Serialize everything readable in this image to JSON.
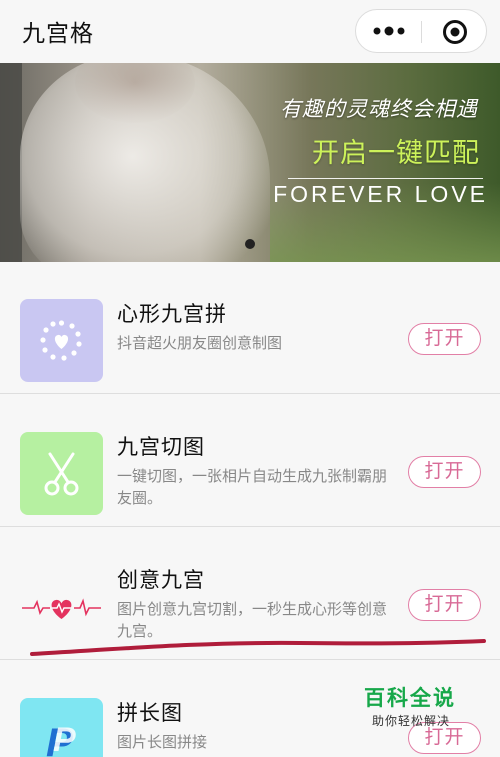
{
  "header": {
    "title": "九宫格",
    "more_icon": "ellipsis-icon",
    "close_icon": "target-circle-icon"
  },
  "banner": {
    "line1": "有趣的灵魂终会相遇",
    "line2": "开启一键匹配",
    "line3": "FOREVER LOVE",
    "accent_color": "#cdf25a"
  },
  "list": {
    "open_color": "#d86a96",
    "items": [
      {
        "title": "心形九宫拼",
        "desc": "抖音超火朋友圈创意制图",
        "button": "打开",
        "icon": "heart-dots-icon",
        "thumb_color": "#c9c7f2"
      },
      {
        "title": "九宫切图",
        "desc": "一键切图，一张相片自动生成九张制霸朋友圈。",
        "button": "打开",
        "icon": "scissors-icon",
        "thumb_color": "#b6f0a1"
      },
      {
        "title": "创意九宫",
        "desc": "图片创意九宫切割，一秒生成心形等创意九宫。",
        "button": "打开",
        "icon": "heartbeat-icon",
        "thumb_color": "#f7f7f7"
      },
      {
        "title": "拼长图",
        "desc": "图片长图拼接",
        "button": "打开",
        "icon": "paypal-icon",
        "thumb_color": "#7fe6f2"
      }
    ]
  },
  "watermark": {
    "title": "百科全说",
    "subtitle": "助你轻松解决"
  }
}
